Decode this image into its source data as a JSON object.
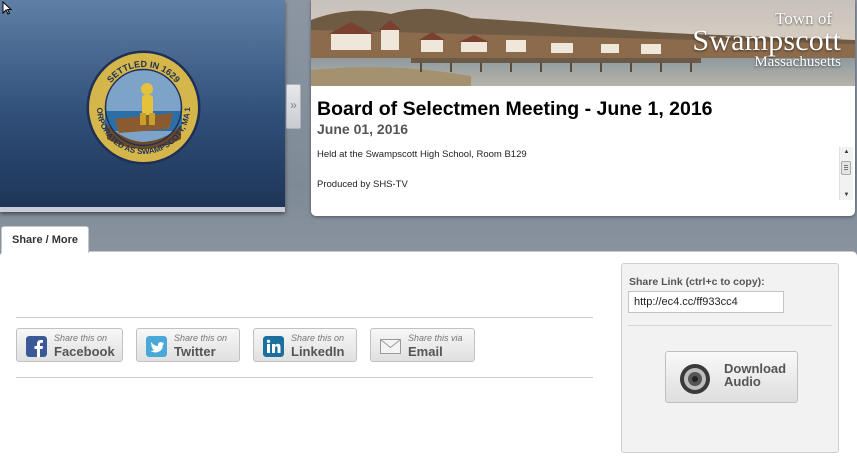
{
  "player": {
    "seal_top_text": "SETTLED IN 1629",
    "seal_bottom_text": "INCORPORATED AS SWAMPSCOTT, MA 1852"
  },
  "collapse_toggle": "»",
  "banner": {
    "line1": "Town of",
    "line2": "Swampscott",
    "line3": "Massachusetts"
  },
  "meeting": {
    "title": "Board of Selectmen Meeting - June 1, 2016",
    "date": "June 01, 2016",
    "description": [
      "Held at the Swampscott High School, Room B129",
      "Produced by SHS-TV"
    ]
  },
  "tabs": [
    {
      "label": "Share / More"
    }
  ],
  "share_buttons": [
    {
      "prefix": "Share this on",
      "label": "Facebook",
      "icon": "facebook-icon",
      "color": "#3b5998"
    },
    {
      "prefix": "Share this on",
      "label": "Twitter",
      "icon": "twitter-icon",
      "color": "#4aa8d8"
    },
    {
      "prefix": "Share this on",
      "label": "LinkedIn",
      "icon": "linkedin-icon",
      "color": "#1a6fa0"
    },
    {
      "prefix": "Share this via",
      "label": "Email",
      "icon": "email-icon",
      "color": "#9a9a9a"
    }
  ],
  "share_link": {
    "label": "Share Link (ctrl+c to copy):",
    "value": "http://ec4.cc/ff933cc4"
  },
  "download": {
    "line1": "Download",
    "line2": "Audio"
  }
}
